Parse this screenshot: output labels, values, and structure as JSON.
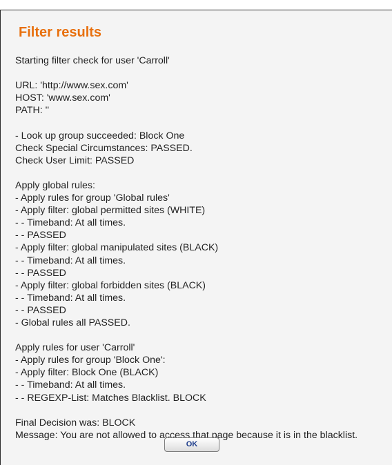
{
  "title": "Filter results",
  "log_lines": [
    "Starting filter check for user 'Carroll'",
    "",
    "URL: 'http://www.sex.com'",
    "HOST: 'www.sex.com'",
    "PATH: ''",
    "",
    "- Look up group succeeded: Block One",
    "Check Special Circumstances: PASSED.",
    "Check User Limit: PASSED",
    "",
    "Apply global rules:",
    "- Apply rules for group 'Global rules'",
    "- Apply filter: global permitted sites (WHITE)",
    "- - Timeband: At all times.",
    "- - PASSED",
    "- Apply filter: global manipulated sites (BLACK)",
    "- - Timeband: At all times.",
    "- - PASSED",
    "- Apply filter: global forbidden sites (BLACK)",
    "- - Timeband: At all times.",
    "- - PASSED",
    "- Global rules all PASSED.",
    "",
    "Apply rules for user 'Carroll'",
    "- Apply rules for group 'Block One':",
    "- Apply filter: Block One (BLACK)",
    "- - Timeband: At all times.",
    "- - REGEXP-List: Matches Blacklist. BLOCK",
    "",
    "Final Decision was: BLOCK",
    "Message: You are not allowed to access that page because it is in the blacklist."
  ],
  "ok_label": "OK"
}
